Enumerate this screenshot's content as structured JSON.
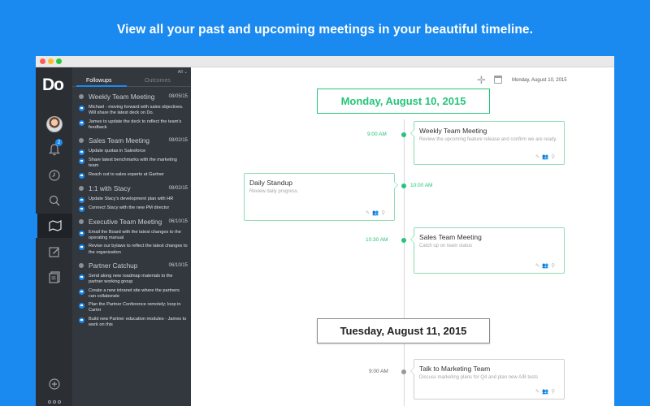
{
  "headline": "View all your past and upcoming meetings in your beautiful timeline.",
  "app": {
    "logo": "Do",
    "notification_count": "2"
  },
  "rail_icons": [
    "avatar",
    "bell-icon",
    "clock-icon",
    "search-icon",
    "map-icon",
    "edit-icon",
    "notes-icon",
    "add-icon",
    "more-icon"
  ],
  "panel": {
    "tab_followups": "Followups",
    "tab_outcomes": "Outcomes",
    "filter": "All",
    "groups": [
      {
        "title": "Weekly Team Meeting",
        "date": "08/05/15",
        "items": [
          "Michael - moving forward with sales objectives. Will share the latest deck on Do.",
          "James to update the deck to reflect the team's feedback"
        ]
      },
      {
        "title": "Sales Team Meeting",
        "date": "08/02/15",
        "items": [
          "Update quotas in Salesforce",
          "Share latest benchmarks with the marketing team",
          "Reach out to sales experts at Gartner"
        ]
      },
      {
        "title": "1:1 with Stacy",
        "date": "08/02/15",
        "items": [
          "Update Stacy's development plan with HR",
          "Connect Stacy with the new PM director"
        ]
      },
      {
        "title": "Executive Team Meeting",
        "date": "06/10/15",
        "items": [
          "Email the Board with the latest changes to the operating manual",
          "Revise our bylaws to reflect the latest changes to the organization"
        ]
      },
      {
        "title": "Partner Catchup",
        "date": "06/10/15",
        "items": [
          "Send along new roadmap materials to the partner working group",
          "Create a new intranet site where the partners can collaborate",
          "Plan the Partner Conference remotely; loop in Carter",
          "Build new Partner education modules - James to work on this"
        ]
      }
    ]
  },
  "toolbar": {
    "date": "Monday, August 10, 2015"
  },
  "timeline": {
    "day1": "Monday, August 10, 2015",
    "day2": "Tuesday, August 11, 2015",
    "events": [
      {
        "time": "9:00 AM",
        "title": "Weekly Team Meeting",
        "desc": "Review the upcoming feature release and confirm we are ready."
      },
      {
        "time": "10:00 AM",
        "title": "Daily Standup",
        "desc": "Review daily progress."
      },
      {
        "time": "10:30 AM",
        "title": "Sales Team Meeting",
        "desc": "Catch up on team status"
      },
      {
        "time": "9:00 AM",
        "title": "Talk to Marketing Team",
        "desc": "Discuss marketing plans for Q4 and plan new A/B tests"
      }
    ]
  },
  "colors": {
    "background": "#1a8af0",
    "accent_green": "#25c47a",
    "rail": "#2b2f34",
    "panel": "#33383e"
  }
}
